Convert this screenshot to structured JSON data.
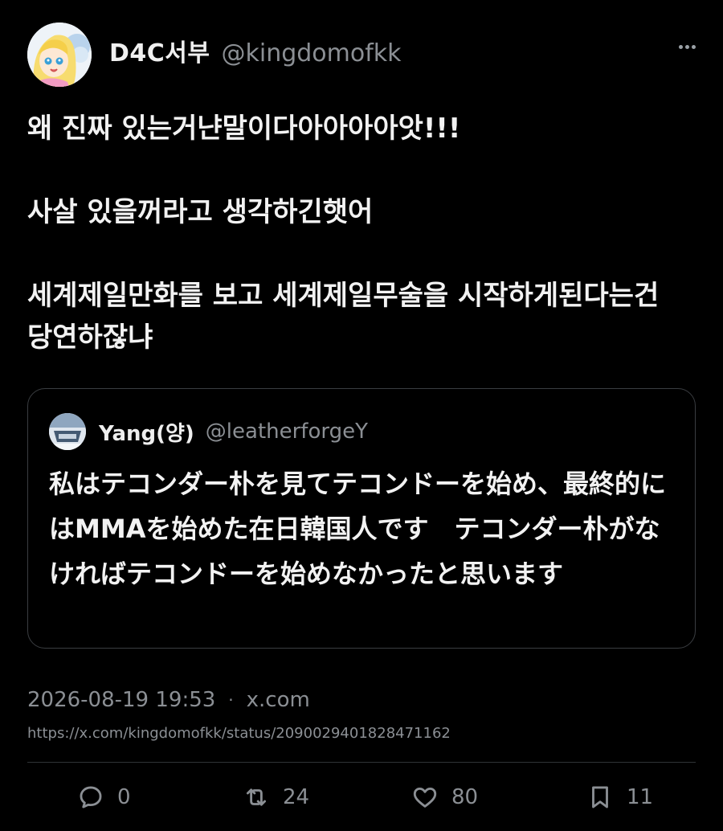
{
  "author": {
    "display_name": "D4C서부",
    "handle": "@kingdomofkk"
  },
  "tweet": {
    "paragraphs": [
      "왜 진짜 있는거냔말이다아아아아앗!!!",
      "사살 있을꺼라고 생각하긴햇어",
      "세계제일만화를 보고 세계제일무술을 시작하게된다는건 당연하잖냐"
    ]
  },
  "quote": {
    "display_name": "Yang(양)",
    "handle": "@leatherforgeY",
    "text": "私はテコンダー朴を見てテコンドーを始め、最終的にはMMAを始めた在日韓国人です　テコンダー朴がなければテコンドーを始めなかったと思います"
  },
  "meta": {
    "datetime": "2026-08-19 19:53",
    "separator": "·",
    "source": "x.com",
    "url": "https://x.com/kingdomofkk/status/2090029401828471162"
  },
  "actions": {
    "replies": "0",
    "reposts": "24",
    "likes": "80",
    "bookmarks": "11"
  },
  "icons": {
    "more": "more-icon",
    "reply": "reply-icon",
    "repost": "repost-icon",
    "like": "like-icon",
    "bookmark": "bookmark-icon"
  },
  "colors": {
    "background": "#000000",
    "text": "#e7e9ea",
    "secondary": "#8b8f94",
    "border": "#3a3d41"
  }
}
